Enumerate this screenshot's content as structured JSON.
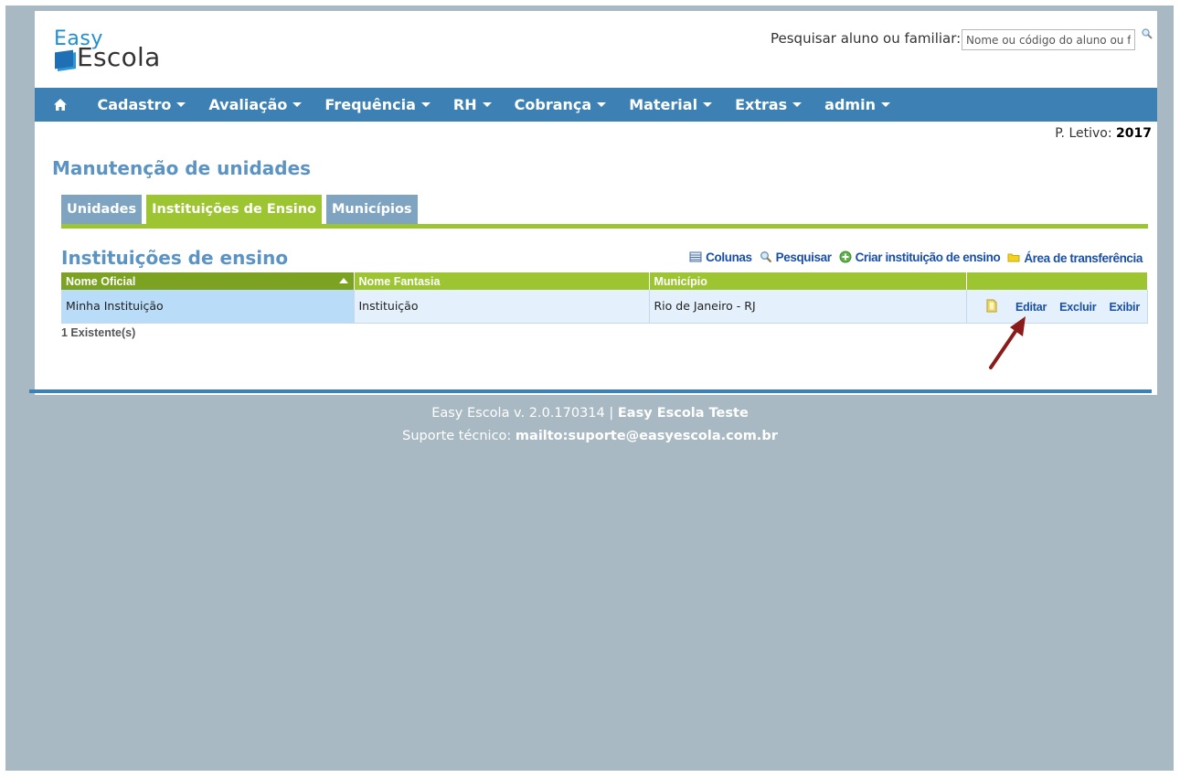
{
  "brand": {
    "line1": "Easy",
    "line2": "Escola"
  },
  "search": {
    "label": "Pesquisar aluno ou familiar:",
    "placeholder": "Nome ou código do aluno ou fa"
  },
  "nav": {
    "items": [
      "Cadastro",
      "Avaliação",
      "Frequência",
      "RH",
      "Cobrança",
      "Material",
      "Extras",
      "admin"
    ]
  },
  "period": {
    "label": "P. Letivo:",
    "value": "2017"
  },
  "page_title": "Manutenção de unidades",
  "tabs": [
    {
      "label": "Unidades",
      "active": false
    },
    {
      "label": "Instituições de Ensino",
      "active": true
    },
    {
      "label": "Municípios",
      "active": false
    }
  ],
  "section_title": "Instituições de ensino",
  "toolbar": {
    "columns": "Colunas",
    "search": "Pesquisar",
    "create": "Criar instituição de ensino",
    "clipboard": "Área de transferência"
  },
  "table": {
    "headers": [
      "Nome Oficial",
      "Nome Fantasia",
      "Município",
      ""
    ],
    "rows": [
      {
        "nome_oficial": "Minha Instituição",
        "nome_fantasia": "Instituição",
        "municipio": "Rio de Janeiro - RJ"
      }
    ],
    "actions": {
      "edit": "Editar",
      "delete": "Excluir",
      "view": "Exibir"
    },
    "count": "1 Existente(s)"
  },
  "footer": {
    "version": "Easy Escola v. 2.0.170314 |",
    "instance": "Easy Escola Teste",
    "support_label": "Suporte técnico:",
    "support_link": "mailto:suporte@easyescola.com.br"
  },
  "colors": {
    "nav": "#3d80b3",
    "accent_green": "#9cc531",
    "tab_inactive": "#7ea4c2",
    "title_blue": "#5b93c2",
    "background": "#a8b9c3"
  }
}
